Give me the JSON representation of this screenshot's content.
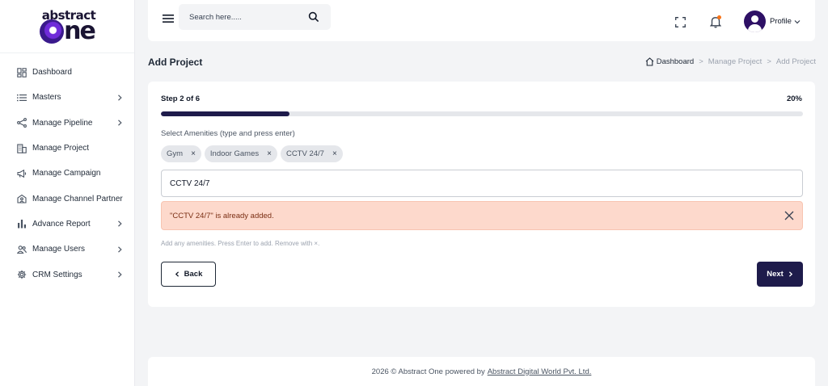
{
  "brand": {
    "top": "abstract",
    "bottom": "ne"
  },
  "sidebar": {
    "items": [
      {
        "label": "Dashboard",
        "icon": "dashboard-icon",
        "has_children": false
      },
      {
        "label": "Masters",
        "icon": "list-icon",
        "has_children": true
      },
      {
        "label": "Manage Pipeline",
        "icon": "pipeline-icon",
        "has_children": true
      },
      {
        "label": "Manage Project",
        "icon": "building-icon",
        "has_children": false
      },
      {
        "label": "Manage Campaign",
        "icon": "megaphone-icon",
        "has_children": false
      },
      {
        "label": "Manage Channel Partner",
        "icon": "partner-icon",
        "has_children": false
      },
      {
        "label": "Advance Report",
        "icon": "bar-chart-icon",
        "has_children": true
      },
      {
        "label": "Manage Users",
        "icon": "users-icon",
        "has_children": true
      },
      {
        "label": "CRM Settings",
        "icon": "gear-icon",
        "has_children": true
      }
    ]
  },
  "header": {
    "search_placeholder": "Search here.....",
    "profile_label": "Profile",
    "notification_dot_color": "#f97316"
  },
  "page": {
    "title": "Add Project",
    "breadcrumb": [
      "Dashboard",
      "Manage Project",
      "Add Project"
    ],
    "breadcrumb_sep": ">"
  },
  "wizard": {
    "step_label": "Step 2 of 6",
    "progress_text": "20%",
    "progress_fraction": 0.2,
    "amenities_label": "Select Amenities (type and press enter)",
    "chips": [
      "Gym",
      "Indoor Games",
      "CCTV 24/7"
    ],
    "chip_remove": "×",
    "input_value": "CCTV 24/7",
    "alert_text": "\"CCTV 24/7\" is already added.",
    "hint": "Add any amenities. Press Enter to add. Remove with ×.",
    "back_label": "Back",
    "next_label": "Next"
  },
  "footer": {
    "text": "2026 © Abstract One powered by",
    "link": "Abstract Digital World Pvt. Ltd."
  },
  "colors": {
    "accent": "#1e1b4b",
    "alert_bg": "#fdd9cc",
    "page_bg": "#f3f4f6"
  }
}
